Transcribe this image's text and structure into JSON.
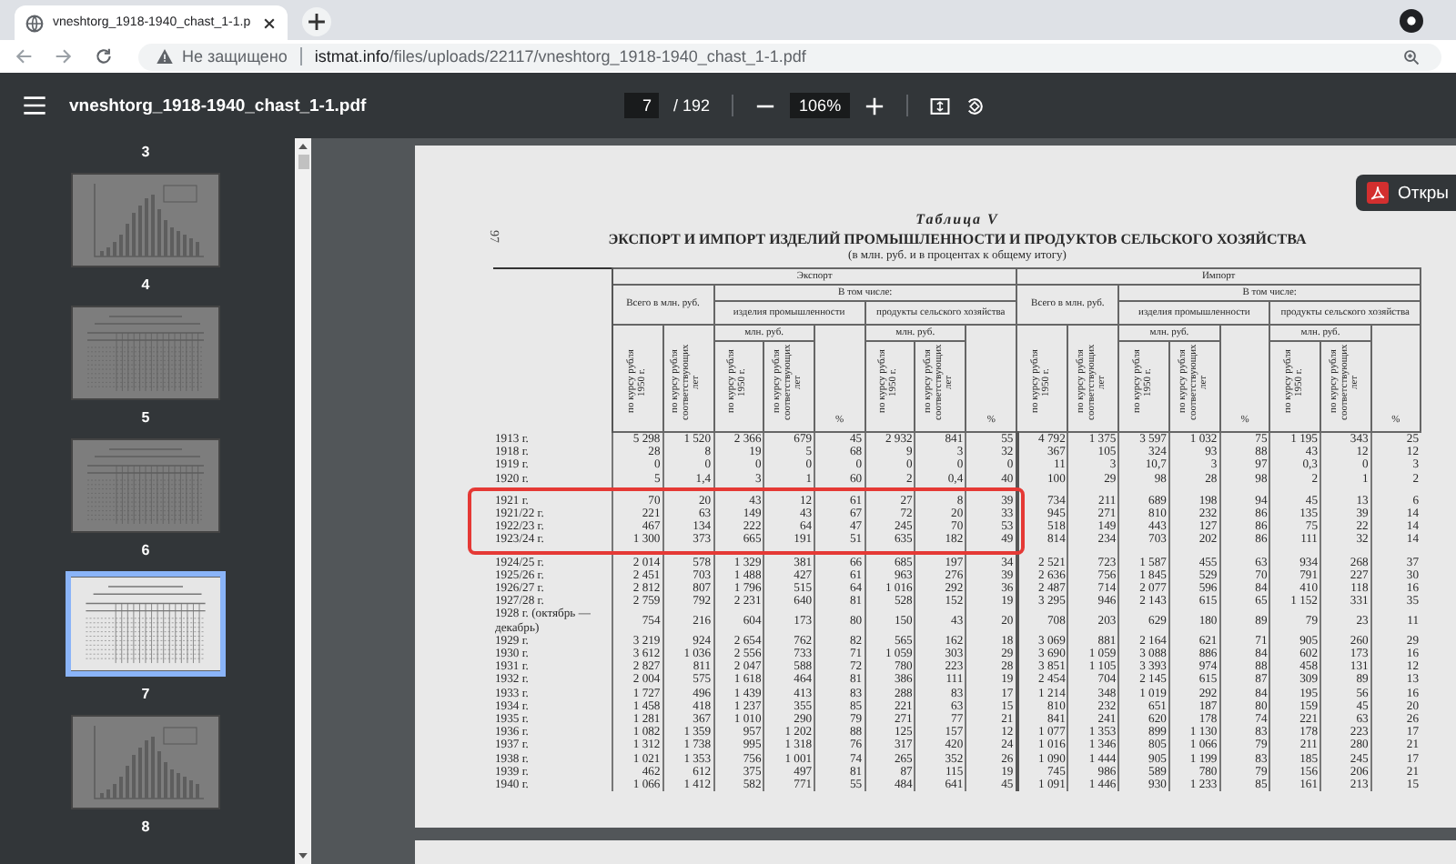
{
  "browser": {
    "tab": {
      "title": "vneshtorg_1918-1940_chast_1-1.p"
    },
    "address": {
      "security": "Не защищено",
      "host": "istmat.info",
      "path": "/files/uploads/22117/vneshtorg_1918-1940_chast_1-1.pdf"
    }
  },
  "viewer": {
    "title": "vneshtorg_1918-1940_chast_1-1.pdf",
    "page": "7",
    "page_total": "/ 192",
    "zoom": "106%"
  },
  "thumbnails": [
    {
      "label": "3",
      "kind": "offscreen",
      "selected": false
    },
    {
      "label": "4",
      "kind": "chart",
      "selected": false
    },
    {
      "label": "5",
      "kind": "table",
      "selected": false
    },
    {
      "label": "6",
      "kind": "table",
      "selected": false
    },
    {
      "label": "7",
      "kind": "table",
      "selected": true
    },
    {
      "label": "8",
      "kind": "chart",
      "selected": false
    }
  ],
  "open_button": {
    "label": "Откры"
  },
  "document": {
    "page_number": "97",
    "caption": "Таблица V",
    "title": "ЭКСПОРТ И ИМПОРТ ИЗДЕЛИЙ ПРОМЫШЛЕННОСТИ И ПРОДУКТОВ СЕЛЬСКОГО ХОЗЯЙСТВА",
    "subtitle": "(в млн. руб. и в процентах к общему итогу)",
    "table": {
      "groups": [
        {
          "label": "Экспорт",
          "total": "Всего в млн. руб.",
          "subgroup": "В том числе:",
          "total_columns": [
            "по курсу рубля 1950 г.",
            "по курсу рубля соответствующих лет"
          ],
          "parts": [
            {
              "label": "изделия промышленности",
              "unit": "млн. руб.",
              "columns": [
                "по курсу рубля 1950 г.",
                "по курсу рубля соответствующих лет",
                "%"
              ]
            },
            {
              "label": "продукты сельского хозяйства",
              "unit": "млн. руб.",
              "columns": [
                "по курсу рубля 1950 г.",
                "по курсу рубля соответствующих лет",
                "%"
              ]
            }
          ]
        },
        {
          "label": "Импорт",
          "total": "Всего в млн. руб.",
          "subgroup": "В том числе:",
          "total_columns": [
            "по курсу рубля 1950 г.",
            "по курсу рубля соответствующих лет"
          ],
          "parts": [
            {
              "label": "изделия промышленности",
              "unit": "млн. руб.",
              "columns": [
                "по курсу рубля 1950 г.",
                "по курсу рубля соответствующих лет",
                "%"
              ]
            },
            {
              "label": "продукты сельского хозяйства",
              "unit": "млн. руб.",
              "columns": [
                "по курсу рубля 1950 г.",
                "по курсу рубля соответствующих лет",
                "%"
              ]
            }
          ]
        }
      ],
      "rows": [
        {
          "label": "1913 г.",
          "highlighted": false,
          "cells": [
            "5 298",
            "1 520",
            "2 366",
            "679",
            "45",
            "2 932",
            "841",
            "55",
            "4 792",
            "1 375",
            "3 597",
            "1 032",
            "75",
            "1 195",
            "343",
            "25"
          ]
        },
        {
          "label": "1918 г.",
          "highlighted": false,
          "cells": [
            "28",
            "8",
            "19",
            "5",
            "68",
            "9",
            "3",
            "32",
            "367",
            "105",
            "324",
            "93",
            "88",
            "43",
            "12",
            "12"
          ]
        },
        {
          "label": "1919 г.",
          "highlighted": false,
          "cells": [
            "0",
            "0",
            "0",
            "0",
            "0",
            "0",
            "0",
            "0",
            "11",
            "3",
            "10,7",
            "3",
            "97",
            "0,3",
            "0",
            "3"
          ]
        },
        {
          "label": "1920 г.",
          "highlighted": false,
          "cells": [
            "5",
            "1,4",
            "3",
            "1",
            "60",
            "2",
            "0,4",
            "40",
            "100",
            "29",
            "98",
            "28",
            "98",
            "2",
            "1",
            "2"
          ]
        },
        {
          "label": "1921 г.",
          "highlighted": true,
          "cells": [
            "70",
            "20",
            "43",
            "12",
            "61",
            "27",
            "8",
            "39",
            "734",
            "211",
            "689",
            "198",
            "94",
            "45",
            "13",
            "6"
          ]
        },
        {
          "label": "1921/22 г.",
          "highlighted": true,
          "cells": [
            "221",
            "63",
            "149",
            "43",
            "67",
            "72",
            "20",
            "33",
            "945",
            "271",
            "810",
            "232",
            "86",
            "135",
            "39",
            "14"
          ]
        },
        {
          "label": "1922/23 г.",
          "highlighted": true,
          "cells": [
            "467",
            "134",
            "222",
            "64",
            "47",
            "245",
            "70",
            "53",
            "518",
            "149",
            "443",
            "127",
            "86",
            "75",
            "22",
            "14"
          ]
        },
        {
          "label": "1923/24 г.",
          "highlighted": true,
          "cells": [
            "1 300",
            "373",
            "665",
            "191",
            "51",
            "635",
            "182",
            "49",
            "814",
            "234",
            "703",
            "202",
            "86",
            "111",
            "32",
            "14"
          ]
        },
        {
          "label": "1924/25 г.",
          "highlighted": false,
          "cells": [
            "2 014",
            "578",
            "1 329",
            "381",
            "66",
            "685",
            "197",
            "34",
            "2 521",
            "723",
            "1 587",
            "455",
            "63",
            "934",
            "268",
            "37"
          ]
        },
        {
          "label": "1925/26 г.",
          "highlighted": false,
          "cells": [
            "2 451",
            "703",
            "1 488",
            "427",
            "61",
            "963",
            "276",
            "39",
            "2 636",
            "756",
            "1 845",
            "529",
            "70",
            "791",
            "227",
            "30"
          ]
        },
        {
          "label": "1926/27 г.",
          "highlighted": false,
          "cells": [
            "2 812",
            "807",
            "1 796",
            "515",
            "64",
            "1 016",
            "292",
            "36",
            "2 487",
            "714",
            "2 077",
            "596",
            "84",
            "410",
            "118",
            "16"
          ]
        },
        {
          "label": "1927/28 г.",
          "highlighted": false,
          "cells": [
            "2 759",
            "792",
            "2 231",
            "640",
            "81",
            "528",
            "152",
            "19",
            "3 295",
            "946",
            "2 143",
            "615",
            "65",
            "1 152",
            "331",
            "35"
          ]
        },
        {
          "label": "1928 г. (октябрь — декабрь)",
          "highlighted": false,
          "cells": [
            "754",
            "216",
            "604",
            "173",
            "80",
            "150",
            "43",
            "20",
            "708",
            "203",
            "629",
            "180",
            "89",
            "79",
            "23",
            "11"
          ]
        },
        {
          "label": "1929 г.",
          "highlighted": false,
          "cells": [
            "3 219",
            "924",
            "2 654",
            "762",
            "82",
            "565",
            "162",
            "18",
            "3 069",
            "881",
            "2 164",
            "621",
            "71",
            "905",
            "260",
            "29"
          ]
        },
        {
          "label": "1930 г.",
          "highlighted": false,
          "cells": [
            "3 612",
            "1 036",
            "2 556",
            "733",
            "71",
            "1 059",
            "303",
            "29",
            "3 690",
            "1 059",
            "3 088",
            "886",
            "84",
            "602",
            "173",
            "16"
          ]
        },
        {
          "label": "1931 г.",
          "highlighted": false,
          "cells": [
            "2 827",
            "811",
            "2 047",
            "588",
            "72",
            "780",
            "223",
            "28",
            "3 851",
            "1 105",
            "3 393",
            "974",
            "88",
            "458",
            "131",
            "12"
          ]
        },
        {
          "label": "1932 г.",
          "highlighted": false,
          "cells": [
            "2 004",
            "575",
            "1 618",
            "464",
            "81",
            "386",
            "111",
            "19",
            "2 454",
            "704",
            "2 145",
            "615",
            "87",
            "309",
            "89",
            "13"
          ]
        },
        {
          "label": "1933 г.",
          "highlighted": false,
          "cells": [
            "1 727",
            "496",
            "1 439",
            "413",
            "83",
            "288",
            "83",
            "17",
            "1 214",
            "348",
            "1 019",
            "292",
            "84",
            "195",
            "56",
            "16"
          ]
        },
        {
          "label": "1934 г.",
          "highlighted": false,
          "cells": [
            "1 458",
            "418",
            "1 237",
            "355",
            "85",
            "221",
            "63",
            "15",
            "810",
            "232",
            "651",
            "187",
            "80",
            "159",
            "45",
            "20"
          ]
        },
        {
          "label": "1935 г.",
          "highlighted": false,
          "cells": [
            "1 281",
            "367",
            "1 010",
            "290",
            "79",
            "271",
            "77",
            "21",
            "841",
            "241",
            "620",
            "178",
            "74",
            "221",
            "63",
            "26"
          ]
        },
        {
          "label": "1936 г.",
          "highlighted": false,
          "cells": [
            "1 082",
            "1 359",
            "957",
            "1 202",
            "88",
            "125",
            "157",
            "12",
            "1 077",
            "1 353",
            "899",
            "1 130",
            "83",
            "178",
            "223",
            "17"
          ]
        },
        {
          "label": "1937 г.",
          "highlighted": false,
          "cells": [
            "1 312",
            "1 738",
            "995",
            "1 318",
            "76",
            "317",
            "420",
            "24",
            "1 016",
            "1 346",
            "805",
            "1 066",
            "79",
            "211",
            "280",
            "21"
          ]
        },
        {
          "label": "1938 г.",
          "highlighted": false,
          "cells": [
            "1 021",
            "1 353",
            "756",
            "1 001",
            "74",
            "265",
            "352",
            "26",
            "1 090",
            "1 444",
            "905",
            "1 199",
            "83",
            "185",
            "245",
            "17"
          ]
        },
        {
          "label": "1939 г.",
          "highlighted": false,
          "cells": [
            "462",
            "612",
            "375",
            "497",
            "81",
            "87",
            "115",
            "19",
            "745",
            "986",
            "589",
            "780",
            "79",
            "156",
            "206",
            "21"
          ]
        },
        {
          "label": "1940 г.",
          "highlighted": false,
          "cells": [
            "1 066",
            "1 412",
            "582",
            "771",
            "55",
            "484",
            "641",
            "45",
            "1 091",
            "1 446",
            "930",
            "1 233",
            "85",
            "161",
            "213",
            "15"
          ]
        }
      ]
    }
  }
}
